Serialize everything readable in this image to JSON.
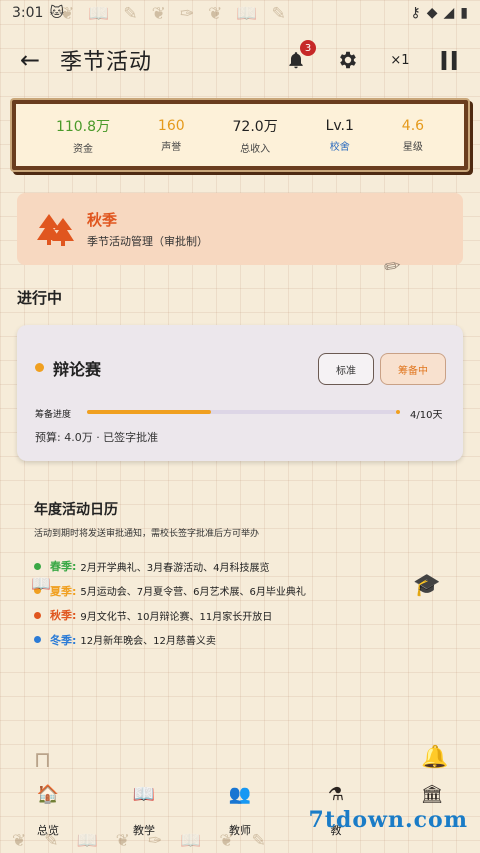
{
  "status": {
    "time": "3:01",
    "icons": [
      "cat-icon",
      "key-icon",
      "wifi-icon",
      "signal-icon",
      "battery-icon"
    ]
  },
  "app_bar": {
    "title": "季节活动",
    "notification_count": "3",
    "speed": "×1"
  },
  "stats": [
    {
      "value": "110.8万",
      "label": "资金",
      "color": "#4a9a2a"
    },
    {
      "value": "160",
      "label": "声誉",
      "color": "#e59a1c"
    },
    {
      "value": "72.0万",
      "label": "总收入",
      "color": "#222222"
    },
    {
      "value": "Lv.1",
      "label": "校舍",
      "color": "#2b6bbf"
    },
    {
      "value": "4.6",
      "label": "星级",
      "color": "#e59a1c"
    }
  ],
  "season": {
    "name": "秋季",
    "subtitle": "季节活动管理（审批制）"
  },
  "ongoing": {
    "section_title": "进行中",
    "event": {
      "name": "辩论赛",
      "mode_standard": "标准",
      "mode_active": "筹备中",
      "progress_label": "筹备进度",
      "progress_fraction": 0.4,
      "progress_count": "4/10天",
      "budget": "预算: 4.0万 · 已签字批准"
    }
  },
  "calendar": {
    "title": "年度活动日历",
    "subtitle": "活动到期时将发送审批通知，需校长签字批准后方可举办",
    "rows": [
      {
        "season": "春季:",
        "events": "2月开学典礼、3月春游活动、4月科技展览",
        "color": "#3aa845"
      },
      {
        "season": "夏季:",
        "events": "5月运动会、7月夏令营、6月艺术展、6月毕业典礼",
        "color": "#f0a020"
      },
      {
        "season": "秋季:",
        "events": "9月文化节、10月辩论赛、11月家长开放日",
        "color": "#e0561f"
      },
      {
        "season": "冬季:",
        "events": "12月新年晚会、12月慈善义卖",
        "color": "#2b7bd6"
      }
    ]
  },
  "nav": [
    {
      "label": "总览",
      "icon": "school-icon"
    },
    {
      "label": "教学",
      "icon": "book-icon"
    },
    {
      "label": "教师",
      "icon": "teachers-icon"
    },
    {
      "label": "教",
      "icon": "flask-icon"
    },
    {
      "label": "",
      "icon": "building-icon"
    }
  ],
  "watermark": "7tdown.com"
}
